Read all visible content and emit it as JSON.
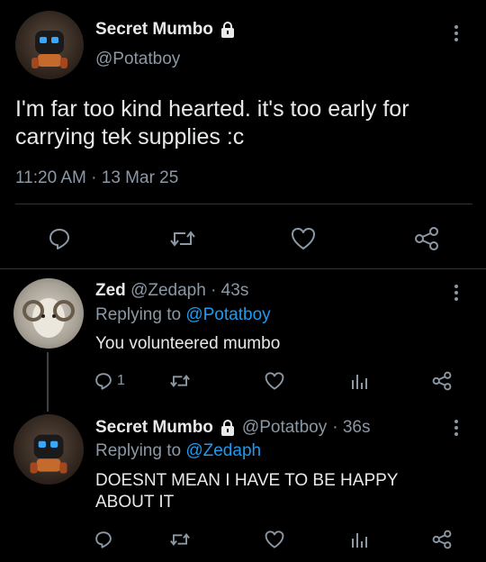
{
  "main_tweet": {
    "display_name": "Secret Mumbo",
    "handle": "@Potatboy",
    "text": "I'm far too kind hearted. it's too early for carrying tek supplies :c",
    "time": "11:20 AM",
    "date": "13 Mar 25",
    "separator": "·"
  },
  "replies": [
    {
      "display_name": "Zed",
      "handle": "@Zedaph",
      "age": "· 43s",
      "replying_prefix": "Replying to",
      "replying_to": "@Potatboy",
      "text": "You volunteered mumbo",
      "reply_count": "1"
    },
    {
      "display_name": "Secret Mumbo",
      "handle": "@Potatboy",
      "age": "· 36s",
      "replying_prefix": "Replying to",
      "replying_to": "@Zedaph",
      "text": "DOESNT MEAN I HAVE TO BE HAPPY ABOUT IT"
    }
  ],
  "colors": {
    "background": "#000000",
    "text": "#e7e9ea",
    "muted": "#8b98a5",
    "link": "#1d9bf0",
    "divider": "#2f3336"
  }
}
